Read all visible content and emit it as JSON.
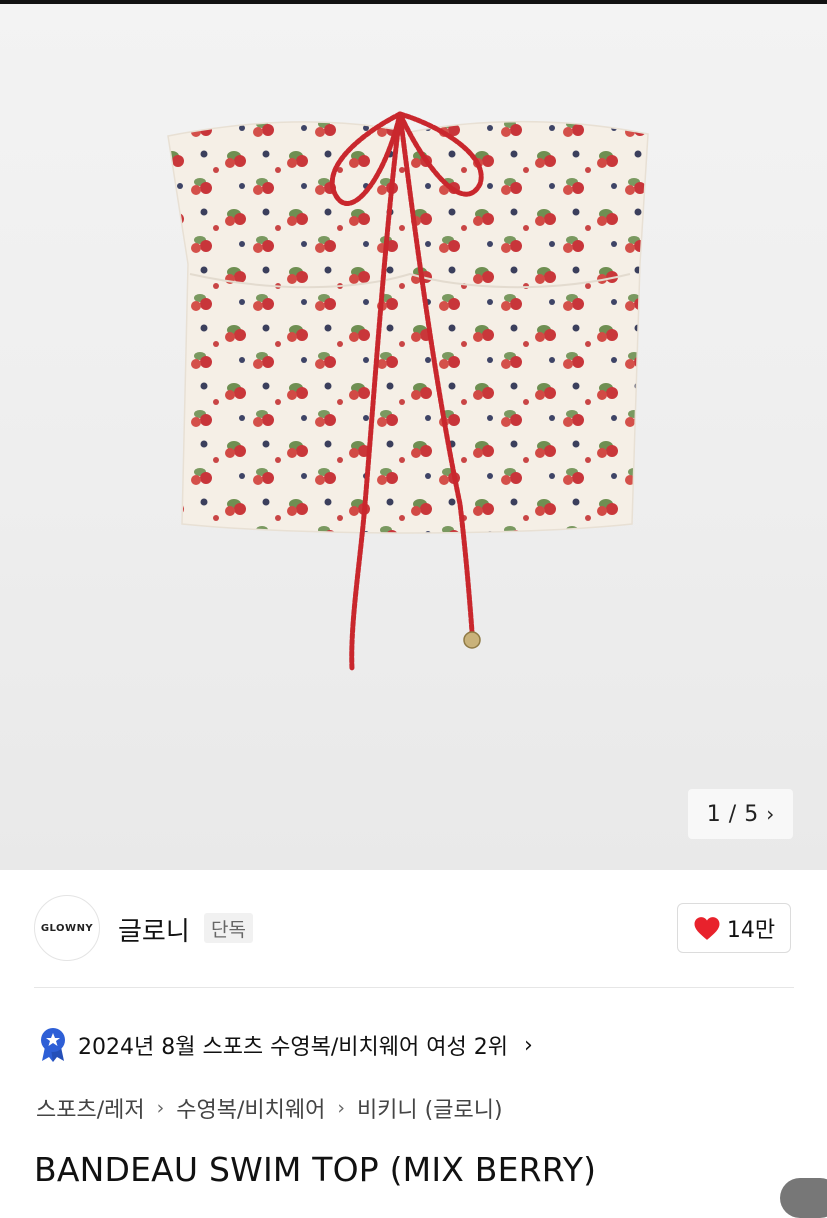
{
  "gallery": {
    "image_alt": "BANDEAU SWIM TOP (MIX BERRY)",
    "counter_current": "1",
    "counter_separator": "/",
    "counter_total": "5",
    "next_icon": "chevron-right-icon"
  },
  "brand": {
    "logo_text": "GLOWNY",
    "name": "글로니",
    "badge": "단독",
    "like_icon": "heart-icon",
    "like_color": "#e8222c",
    "like_count": "14만"
  },
  "ranking": {
    "icon": "award-badge-icon",
    "icon_color": "#2e5fd6",
    "text": "2024년 8월 스포츠 수영복/비치웨어 여성 2위",
    "chevron_icon": "chevron-right-icon"
  },
  "breadcrumb": {
    "items": [
      "스포츠/레저",
      "수영복/비치웨어",
      "비키니 (글로니)"
    ],
    "separator_icon": "chevron-right-icon"
  },
  "product": {
    "title": "BANDEAU SWIM TOP (MIX BERRY)"
  }
}
